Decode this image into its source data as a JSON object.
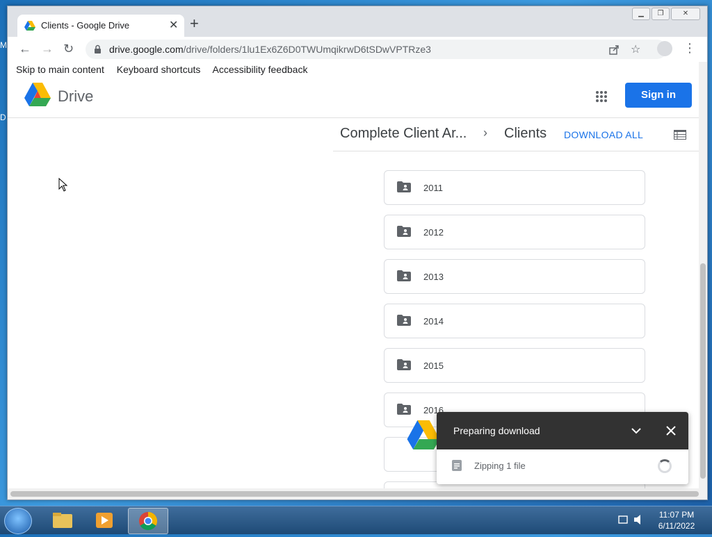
{
  "desktop": {
    "frag_top": "M",
    "frag_mid": "D"
  },
  "browser": {
    "tab_title": "Clients - Google Drive",
    "url_host": "drive.google.com",
    "url_path": "/drive/folders/1lu1Ex6Z6D0TWUmqikrwD6tSDwVPTRze3"
  },
  "page": {
    "skip_links": [
      "Skip to main content",
      "Keyboard shortcuts",
      "Accessibility feedback"
    ],
    "brand": "Drive",
    "signin_label": "Sign in",
    "breadcrumb": {
      "parent": "Complete Client Ar...",
      "current": "Clients"
    },
    "download_all": "DOWNLOAD ALL",
    "folders": [
      "2011",
      "2012",
      "2013",
      "2014",
      "2015",
      "2016"
    ]
  },
  "download_panel": {
    "title": "Preparing download",
    "status": "Zipping 1 file"
  },
  "taskbar": {
    "time": "11:07 PM",
    "date": "6/11/2022"
  },
  "colors": {
    "accent": "#1a73e8",
    "panel_dark": "#323232"
  }
}
